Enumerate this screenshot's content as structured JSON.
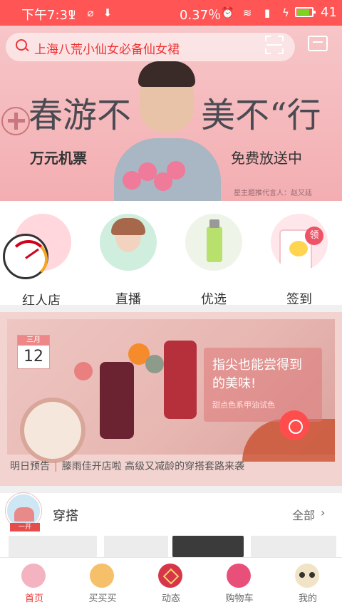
{
  "status_bar": {
    "time": "下午7:31",
    "battery_pct": "0.37％",
    "battery_level": "41",
    "icons": [
      "usb-icon",
      "usb-debug-icon",
      "download-icon",
      "alarm-icon",
      "wifi-icon",
      "signal-icon",
      "charging-icon",
      "battery-icon"
    ]
  },
  "search": {
    "placeholder": "上海八荒小仙女必备仙女裙",
    "icons": [
      "search-icon",
      "scan-icon",
      "message-icon"
    ]
  },
  "banner": {
    "headline_left": "春游不",
    "headline_right": "美不“行",
    "sub_left": "万元机票",
    "sub_right": "免费放送中",
    "credit": "星主题推代言人：赵又廷"
  },
  "quick_links": [
    {
      "label": "红人店",
      "icon": "gauge-icon"
    },
    {
      "label": "直播",
      "icon": "live-girl-icon"
    },
    {
      "label": "优选",
      "icon": "perfume-bottle-icon"
    },
    {
      "label": "签到",
      "icon": "checkin-phone-icon",
      "badge": "领"
    }
  ],
  "promo": {
    "calendar_month": "三月",
    "calendar_day": "12",
    "tagline_main": "指尖也能尝得到的美味!",
    "tagline_sub": "甜点色系甲油试色",
    "preview_label": "明日预告",
    "preview_sep": "|",
    "preview_text": "滕雨佳开店啦 高级又减龄的穿搭套路来袭"
  },
  "section": {
    "badge": "一开",
    "title": "穿搭",
    "more": "全部",
    "more_arrow": "›"
  },
  "tabs": [
    {
      "label": "首页",
      "icon": "home-icon",
      "active": true
    },
    {
      "label": "买买买",
      "icon": "shopping-bag-icon",
      "active": false
    },
    {
      "label": "动态",
      "icon": "moments-icon",
      "active": false
    },
    {
      "label": "购物车",
      "icon": "cart-icon",
      "active": false
    },
    {
      "label": "我的",
      "icon": "profile-icon",
      "active": false
    }
  ],
  "colors": {
    "accent": "#ff4d4d",
    "status_bar": "#ff5555",
    "text": "#333333",
    "divider": "#f0f0f0"
  }
}
